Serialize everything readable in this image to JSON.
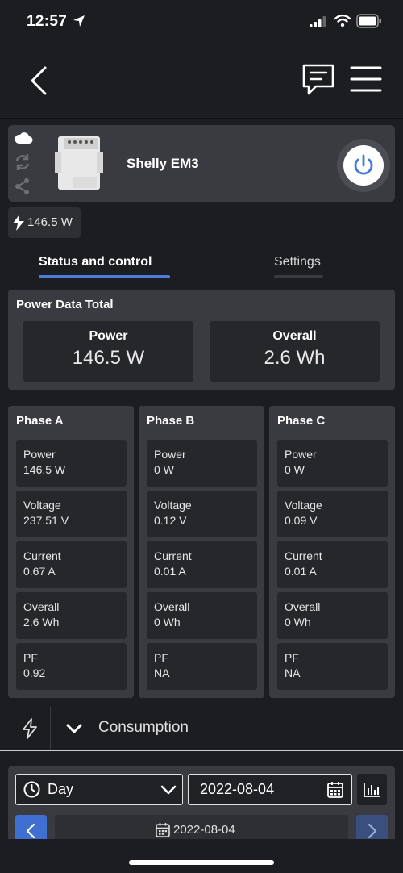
{
  "status_bar": {
    "time": "12:57"
  },
  "device": {
    "name": "Shelly EM3"
  },
  "power_badge": {
    "value": "146.5 W"
  },
  "tabs": [
    {
      "label": "Status and control",
      "active": true
    },
    {
      "label": "Settings",
      "active": false
    }
  ],
  "power_total": {
    "title": "Power Data Total",
    "power": {
      "label": "Power",
      "value": "146.5 W"
    },
    "overall": {
      "label": "Overall",
      "value": "2.6 Wh"
    }
  },
  "phases": [
    {
      "title": "Phase A",
      "power": "146.5 W",
      "voltage": "237.51 V",
      "current": "0.67 A",
      "overall": "2.6 Wh",
      "pf": "0.92"
    },
    {
      "title": "Phase B",
      "power": "0 W",
      "voltage": "0.12 V",
      "current": "0.01 A",
      "overall": "0 Wh",
      "pf": "NA"
    },
    {
      "title": "Phase C",
      "power": "0 W",
      "voltage": "0.09 V",
      "current": "0.01 A",
      "overall": "0 Wh",
      "pf": "NA"
    }
  ],
  "metric_labels": {
    "power": "Power",
    "voltage": "Voltage",
    "current": "Current",
    "overall": "Overall",
    "pf": "PF"
  },
  "consumption": {
    "label": "Consumption",
    "period": "Day",
    "date": "2022-08-04",
    "current_date": "2022-08-04"
  },
  "colors": {
    "accent": "#4f7bdc",
    "background": "#1c1d20",
    "card": "#3a3b40",
    "inner": "#26272a"
  }
}
